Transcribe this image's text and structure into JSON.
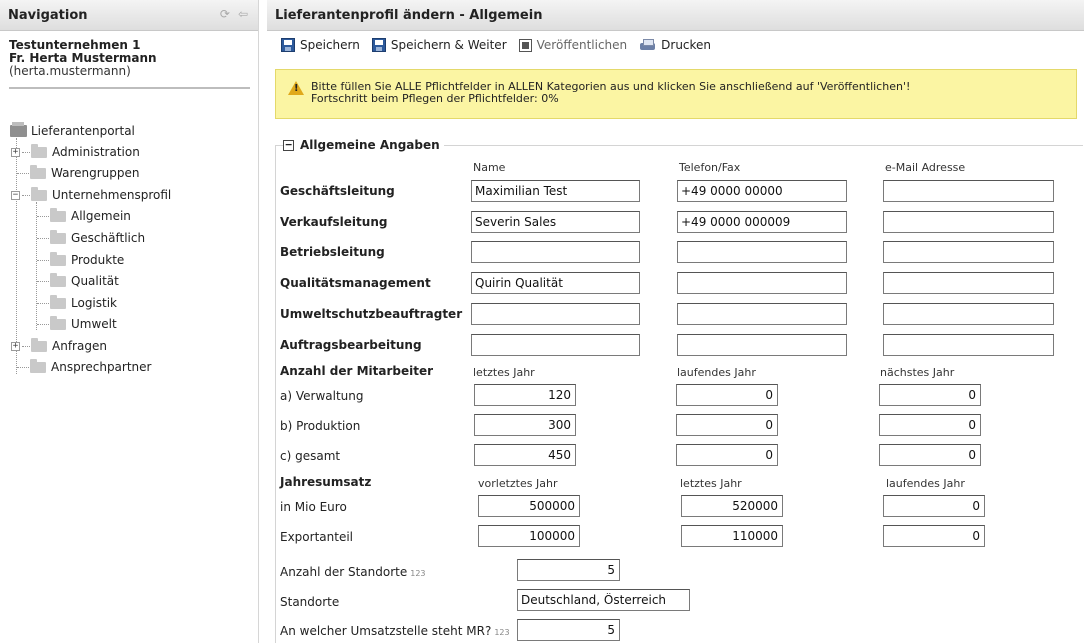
{
  "sidebar": {
    "title": "Navigation",
    "user": {
      "company": "Testunternehmen 1",
      "name": "Fr. Herta Mustermann",
      "login": "(herta.mustermann)"
    },
    "tree": {
      "root": "Lieferantenportal",
      "items": [
        {
          "label": "Administration"
        },
        {
          "label": "Warengruppen"
        },
        {
          "label": "Unternehmensprofil"
        },
        {
          "label": "Allgemein"
        },
        {
          "label": "Geschäftlich"
        },
        {
          "label": "Produkte"
        },
        {
          "label": "Qualität"
        },
        {
          "label": "Logistik"
        },
        {
          "label": "Umwelt"
        },
        {
          "label": "Anfragen"
        },
        {
          "label": "Ansprechpartner"
        }
      ]
    }
  },
  "main": {
    "title": "Lieferantenprofil ändern - Allgemein",
    "toolbar": {
      "save": "Speichern",
      "save_next": "Speichern & Weiter",
      "publish": "Veröffentlichen",
      "print": "Drucken"
    },
    "notice": {
      "line1": "Bitte füllen Sie ALLE Pflichtfelder in ALLEN Kategorien aus und klicken Sie anschließend auf 'Veröffentlichen'!",
      "line2": "Fortschritt beim Pflegen der Pflichtfelder: 0%"
    },
    "section": {
      "title": "Allgemeine Angaben",
      "columns": [
        "Name",
        "Telefon/Fax",
        "e-Mail Adresse"
      ],
      "contacts": [
        {
          "label": "Geschäftsleitung",
          "name": "Maximilian Test",
          "phone": "+49 0000 00000",
          "email": ""
        },
        {
          "label": "Verkaufsleitung",
          "name": "Severin Sales",
          "phone": "+49 0000 000009",
          "email": ""
        },
        {
          "label": "Betriebsleitung",
          "name": "",
          "phone": "",
          "email": ""
        },
        {
          "label": "Qualitätsmanagement",
          "name": "Quirin Qualität",
          "phone": "",
          "email": ""
        },
        {
          "label": "Umweltschutzbeauftragter",
          "name": "",
          "phone": "",
          "email": ""
        },
        {
          "label": "Auftragsbearbeitung",
          "name": "",
          "phone": "",
          "email": ""
        }
      ],
      "staff": {
        "label": "Anzahl der Mitarbeiter",
        "columns": [
          "letztes Jahr",
          "laufendes Jahr",
          "nächstes Jahr"
        ],
        "rows": [
          {
            "label": "a) Verwaltung",
            "values": [
              "120",
              "0",
              "0"
            ]
          },
          {
            "label": "b) Produktion",
            "values": [
              "300",
              "0",
              "0"
            ]
          },
          {
            "label": "c) gesamt",
            "values": [
              "450",
              "0",
              "0"
            ]
          }
        ]
      },
      "revenue": {
        "label": "Jahresumsatz",
        "columns": [
          "vorletztes Jahr",
          "letztes Jahr",
          "laufendes Jahr"
        ],
        "rows": [
          {
            "label": "in Mio Euro",
            "values": [
              "500000",
              "520000",
              "0"
            ]
          },
          {
            "label": "Exportanteil",
            "values": [
              "100000",
              "110000",
              "0"
            ]
          }
        ]
      },
      "locations_count": {
        "label": "Anzahl der Standorte",
        "sup": "123",
        "value": "5"
      },
      "locations": {
        "label": "Standorte",
        "value": "Deutschland, Österreich"
      },
      "rank": {
        "label": "An welcher Umsatzstelle steht MR?",
        "sup": "123",
        "value": "5"
      }
    }
  }
}
